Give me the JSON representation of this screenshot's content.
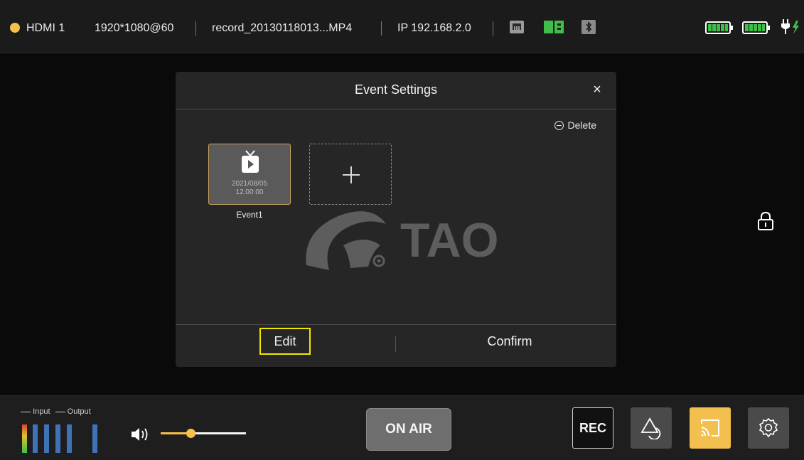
{
  "status_bar": {
    "source": "HDMI 1",
    "resolution": "1920*1080@60",
    "filename": "record_20130118013...MP4",
    "ip": "IP 192.168.2.0",
    "icons": [
      "ethernet-icon",
      "sd-card-icon",
      "bluetooth-icon",
      "battery-icon",
      "battery-icon",
      "power-plug-icon"
    ],
    "dot_color": "#f7c04a"
  },
  "dialog": {
    "title": "Event Settings",
    "close_glyph": "×",
    "delete_label": "Delete",
    "events": [
      {
        "label": "Event1",
        "date": "2021/08/05",
        "time": "12:00:00",
        "icon": "tv-play-icon"
      }
    ],
    "add_icon": "plus-icon",
    "watermark": "TAO",
    "edit_label": "Edit",
    "confirm_label": "Confirm",
    "highlight_color": "#f3e600"
  },
  "side": {
    "lock_icon": "lock-icon"
  },
  "bottom_bar": {
    "legend_input": "Input",
    "legend_output": "Output",
    "volume": 0.35,
    "on_air_label": "ON AIR",
    "rec_label": "REC",
    "accent_color": "#f3bf4f"
  }
}
